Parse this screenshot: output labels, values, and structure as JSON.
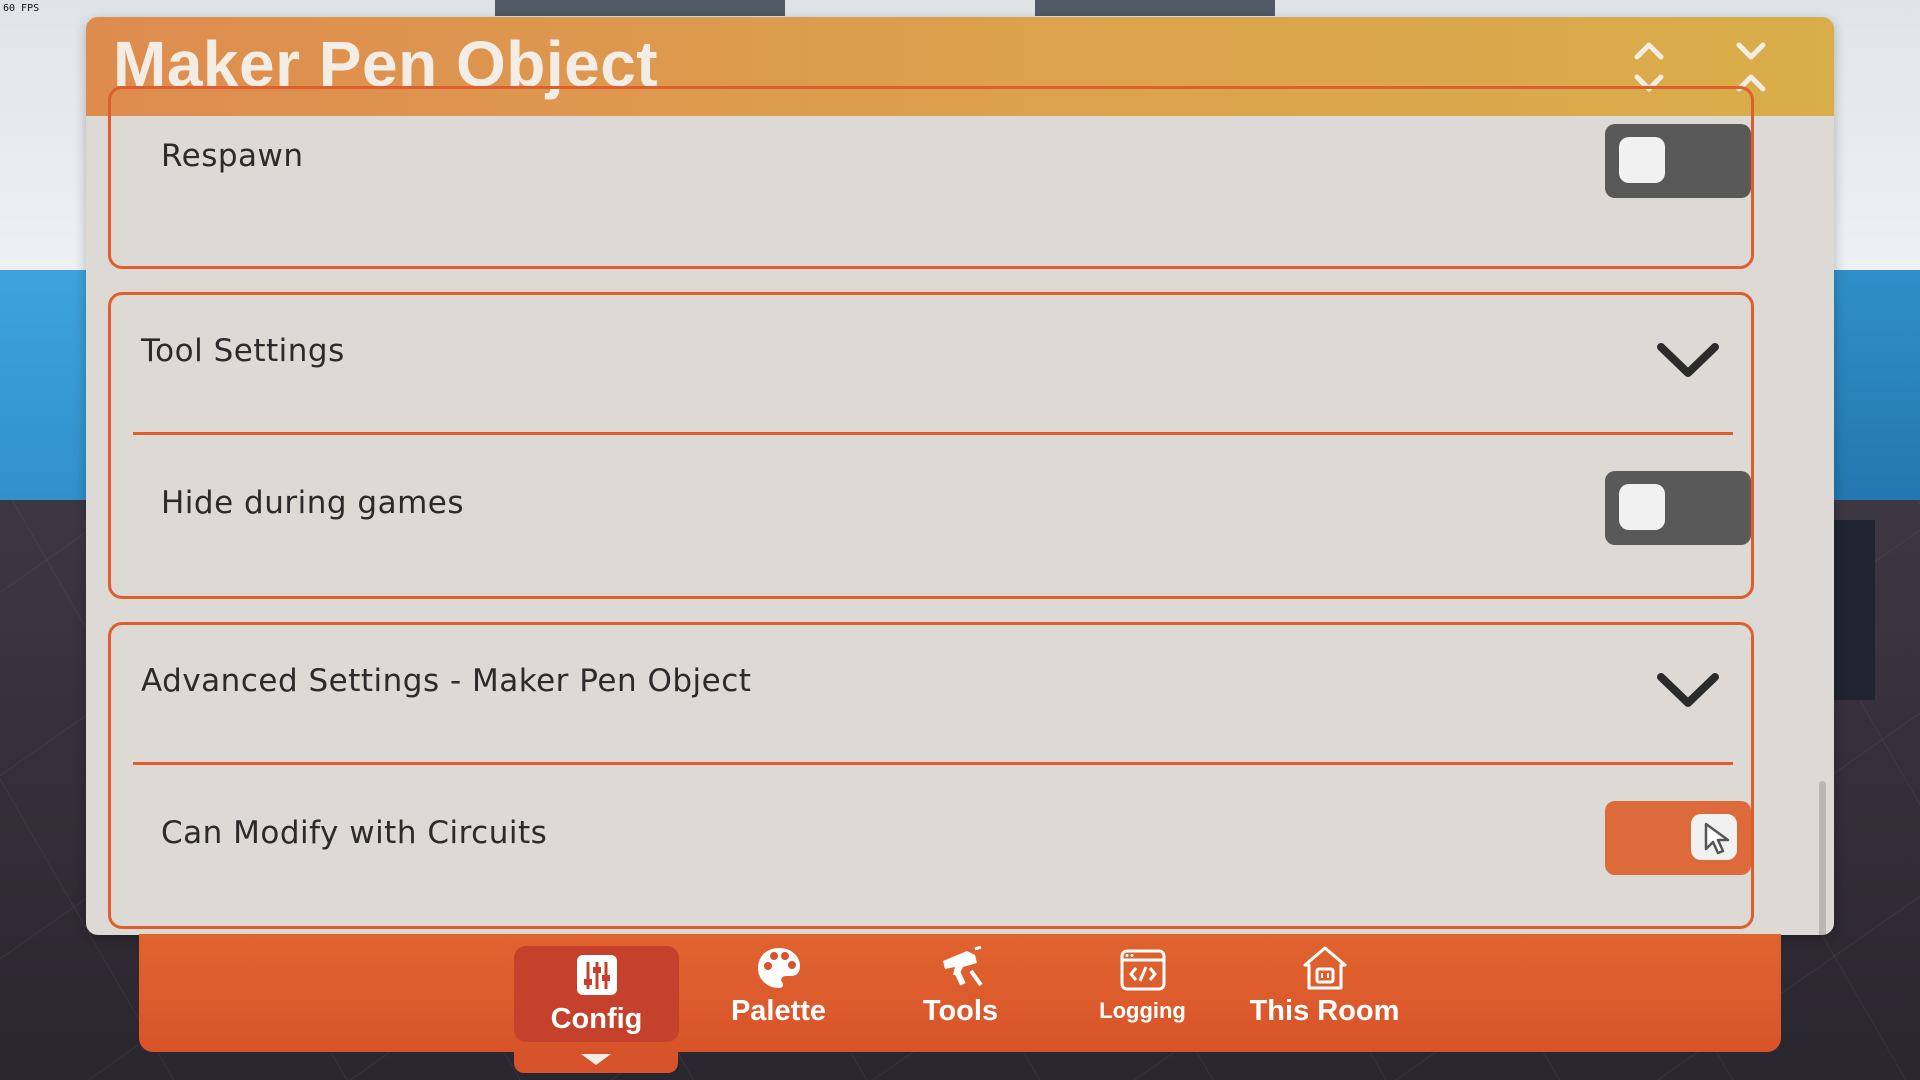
{
  "fps": "60 FPS",
  "panel": {
    "title": "Maker Pen Object"
  },
  "sections": {
    "respawn": {
      "label": "Respawn",
      "enabled": false
    },
    "tool_settings": {
      "header": "Tool Settings",
      "hide_during_games": {
        "label": "Hide during games",
        "enabled": false
      }
    },
    "advanced": {
      "header": "Advanced Settings - Maker Pen Object",
      "can_modify_circuits": {
        "label": "Can Modify with Circuits",
        "enabled": true
      }
    }
  },
  "tabs": [
    {
      "label": "Config",
      "icon": "sliders-icon",
      "active": true
    },
    {
      "label": "Palette",
      "icon": "palette-icon",
      "active": false
    },
    {
      "label": "Tools",
      "icon": "maker-pen-icon",
      "active": false
    },
    {
      "label": "Logging",
      "icon": "code-window-icon",
      "active": false
    },
    {
      "label": "This Room",
      "icon": "house-icon",
      "active": false
    }
  ],
  "colors": {
    "accent": "#e05e2e",
    "title_bar": "#dca24d",
    "toggle_off": "#595959",
    "toggle_on": "#dd6a3a",
    "panel_bg": "#ddd9d4"
  }
}
